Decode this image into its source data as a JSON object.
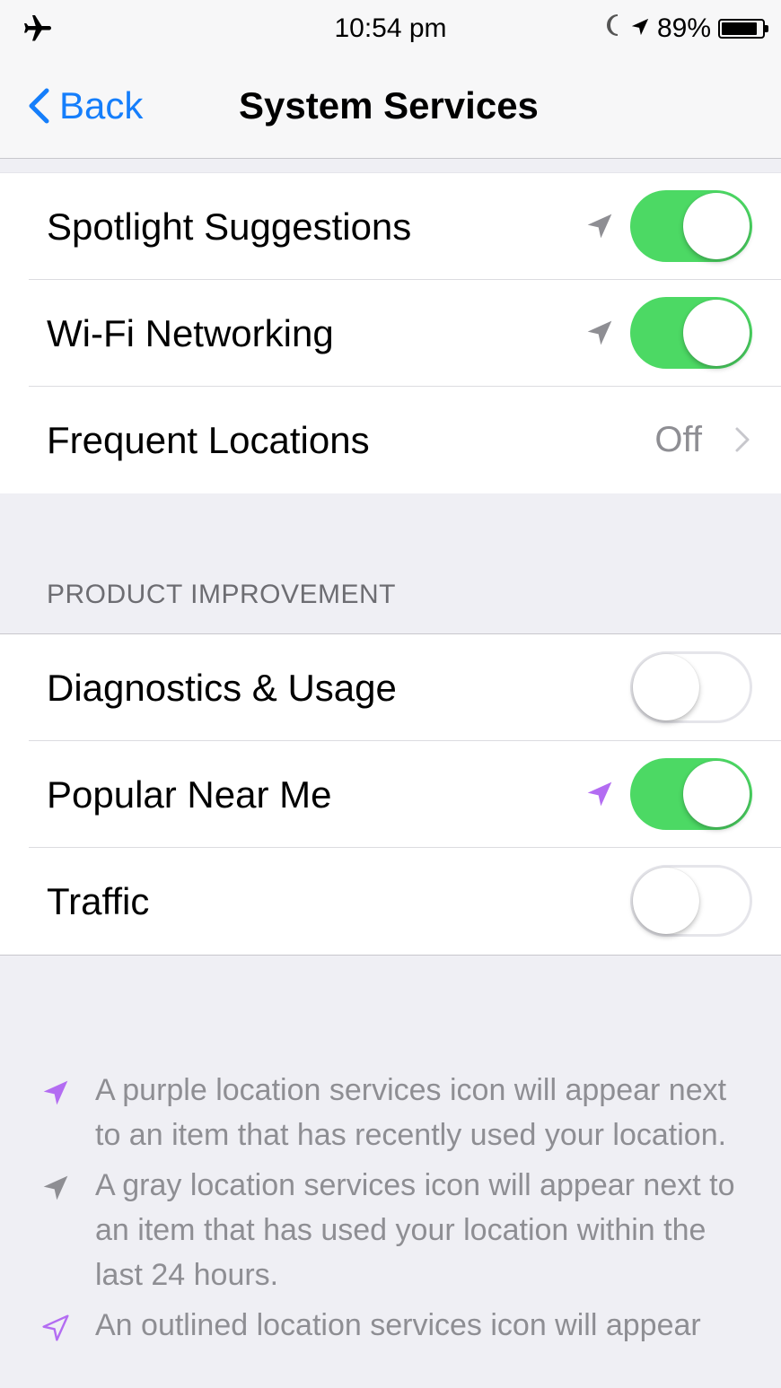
{
  "status_bar": {
    "left_icon": "airplane-icon",
    "time": "10:54 pm",
    "right_icons": [
      "moon-icon",
      "location-arrow-icon"
    ],
    "battery_percent": "89%",
    "battery_level": 0.89
  },
  "nav": {
    "back_label": "Back",
    "title": "System Services"
  },
  "colors": {
    "accent_blue": "#157efb",
    "switch_on": "#4cd964",
    "location_gray": "#8e8e93",
    "location_purple": "#b36cf2",
    "group_background": "#efeff4"
  },
  "rows_top": [
    {
      "label": "Spotlight Suggestions",
      "location_icon": "gray",
      "switch_on": true
    },
    {
      "label": "Wi-Fi Networking",
      "location_icon": "gray",
      "switch_on": true
    },
    {
      "label": "Frequent Locations",
      "value": "Off"
    }
  ],
  "product_improvement": {
    "header": "PRODUCT IMPROVEMENT",
    "rows": [
      {
        "label": "Diagnostics & Usage",
        "switch_on": false
      },
      {
        "label": "Popular Near Me",
        "location_icon": "purple",
        "switch_on": true
      },
      {
        "label": "Traffic",
        "switch_on": false
      }
    ]
  },
  "footer": {
    "items": [
      {
        "icon": "purple-location-icon",
        "text": "A purple location services icon will appear next to an item that has recently used your location."
      },
      {
        "icon": "gray-location-icon",
        "text": "A gray location services icon will appear next to an item that has used your location within the last 24 hours."
      },
      {
        "icon": "outlined-location-icon",
        "text": "An outlined location services icon will appear"
      }
    ]
  }
}
